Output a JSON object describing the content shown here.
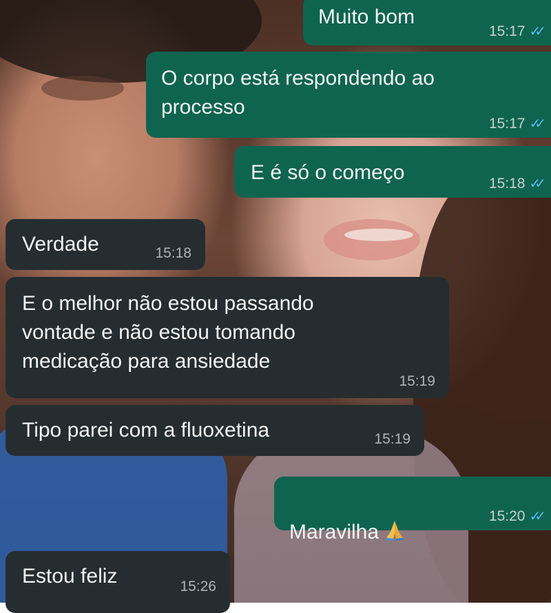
{
  "messages": [
    {
      "id": "m1",
      "direction": "outgoing",
      "text": "Muito bom",
      "time": "15:17",
      "status": "read"
    },
    {
      "id": "m2",
      "direction": "outgoing",
      "text": "O corpo está respondendo ao\nprocesso",
      "time": "15:17",
      "status": "read"
    },
    {
      "id": "m3",
      "direction": "outgoing",
      "text": "E é só o começo",
      "time": "15:18",
      "status": "read"
    },
    {
      "id": "m4",
      "direction": "incoming",
      "text": "Verdade",
      "time": "15:18"
    },
    {
      "id": "m5",
      "direction": "incoming",
      "text": "E o melhor não estou  passando\nvontade e não estou tomando\nmedicação para ansiedade",
      "time": "15:19"
    },
    {
      "id": "m6",
      "direction": "incoming",
      "text": "Tipo parei com a fluoxetina",
      "time": "15:19"
    },
    {
      "id": "m7",
      "direction": "outgoing",
      "text": "Maravilha",
      "emoji": "folded-hands-icon",
      "time": "15:20",
      "status": "read"
    },
    {
      "id": "m8",
      "direction": "incoming",
      "text": "Estou feliz",
      "time": "15:26"
    }
  ],
  "colors": {
    "outgoing_bubble": "#0f6450",
    "incoming_bubble": "#262d31",
    "read_ticks": "#53bdeb",
    "text": "#f3f5f4"
  }
}
